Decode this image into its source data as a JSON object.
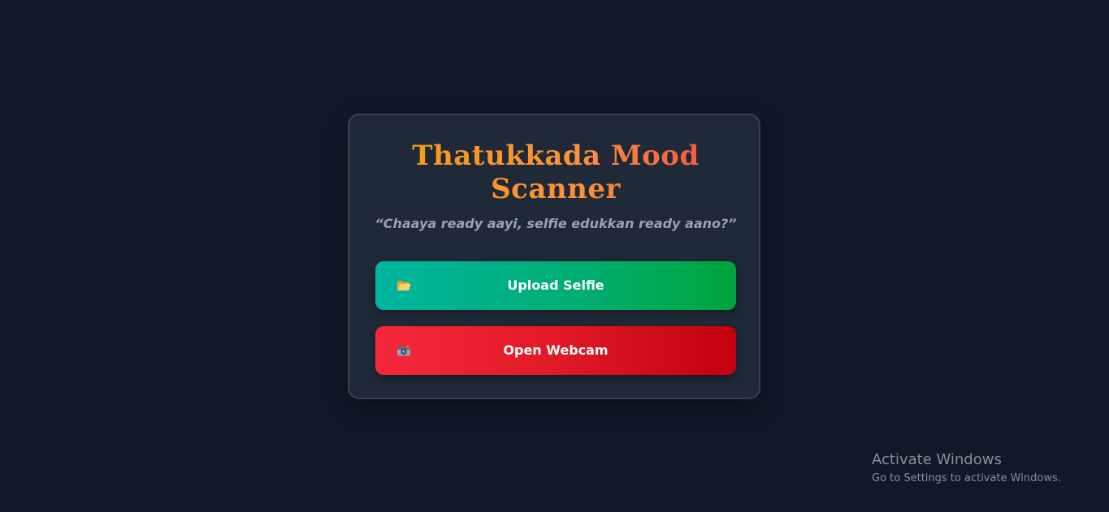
{
  "app": {
    "title": "Thatukkada Mood Scanner",
    "subtitle": "“Chaaya ready aayi, selfie edukkan ready aano?”"
  },
  "actions": {
    "upload": {
      "label": "Upload Selfie",
      "icon": "folder-icon"
    },
    "webcam": {
      "label": "Open Webcam",
      "icon": "camera-icon"
    }
  },
  "watermark": {
    "title": "Activate Windows",
    "subtitle": "Go to Settings to activate Windows."
  },
  "colors": {
    "background": "#111827",
    "card": "#1f2937",
    "title_gradient_start": "#f59e0b",
    "title_gradient_end": "#ef4444",
    "upload_button": "#00b5a0",
    "webcam_button": "#e01a26"
  }
}
